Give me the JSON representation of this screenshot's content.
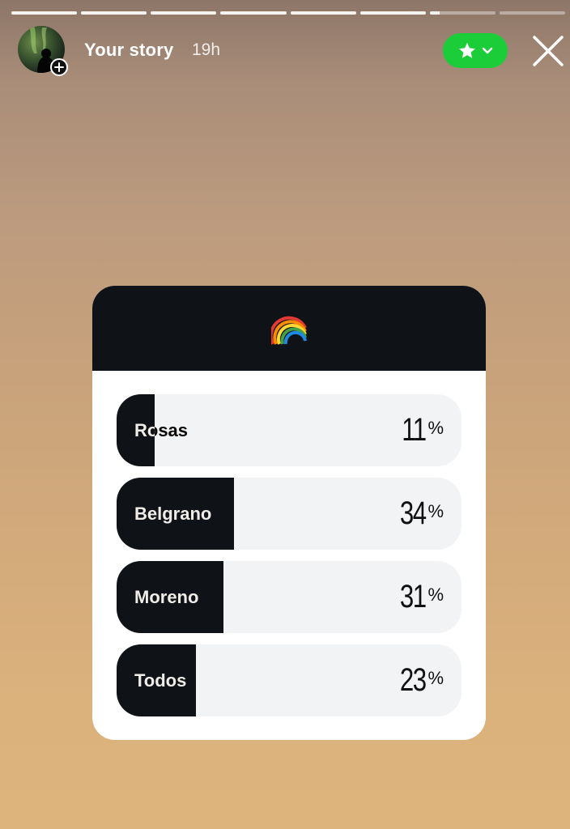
{
  "story": {
    "progress": [
      1,
      1,
      1,
      1,
      1,
      1,
      0.15,
      0
    ],
    "username": "Your story",
    "time": "19h",
    "favorite_icon": "star-icon",
    "close_icon": "close-icon"
  },
  "poll": {
    "sticker": "🌈",
    "options": [
      {
        "label": "Rosas",
        "percent": "11",
        "sign": "%"
      },
      {
        "label": "Belgrano",
        "percent": "34",
        "sign": "%"
      },
      {
        "label": "Moreno",
        "percent": "31",
        "sign": "%"
      },
      {
        "label": "Todos",
        "percent": "23",
        "sign": "%"
      }
    ]
  },
  "colors": {
    "accent_green": "#1ccd3a",
    "poll_dark": "#0f1216",
    "bar_track": "#f2f3f5"
  }
}
